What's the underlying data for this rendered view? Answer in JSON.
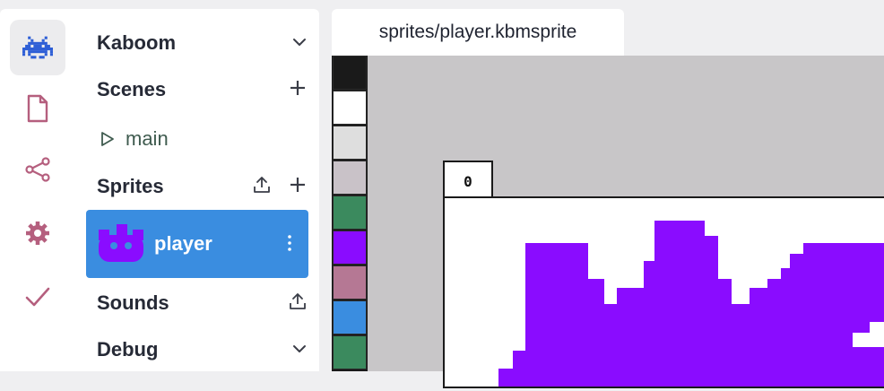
{
  "activity_bar": {
    "icons": [
      "game-icon",
      "file-icon",
      "share-icon",
      "gear-icon",
      "check-icon"
    ],
    "accent": "#2e5fd6",
    "muted": "#b55f7e"
  },
  "sidebar": {
    "project": {
      "title": "Kaboom"
    },
    "scenes": {
      "title": "Scenes",
      "items": [
        "main"
      ]
    },
    "sprites": {
      "title": "Sprites",
      "items": [
        "player"
      ]
    },
    "sounds": {
      "title": "Sounds"
    },
    "debug": {
      "title": "Debug"
    }
  },
  "editor": {
    "tab_label": "sprites/player.kbmsprite",
    "frame_label": "0",
    "palette": [
      "#1a1a1a",
      "#ffffff",
      "#dedede",
      "#c9c2c8",
      "#3b8a5e",
      "#8a0cff",
      "#b57894",
      "#3a8de0",
      "#3b8a5e"
    ],
    "sprite_color": "#8a0cff"
  }
}
